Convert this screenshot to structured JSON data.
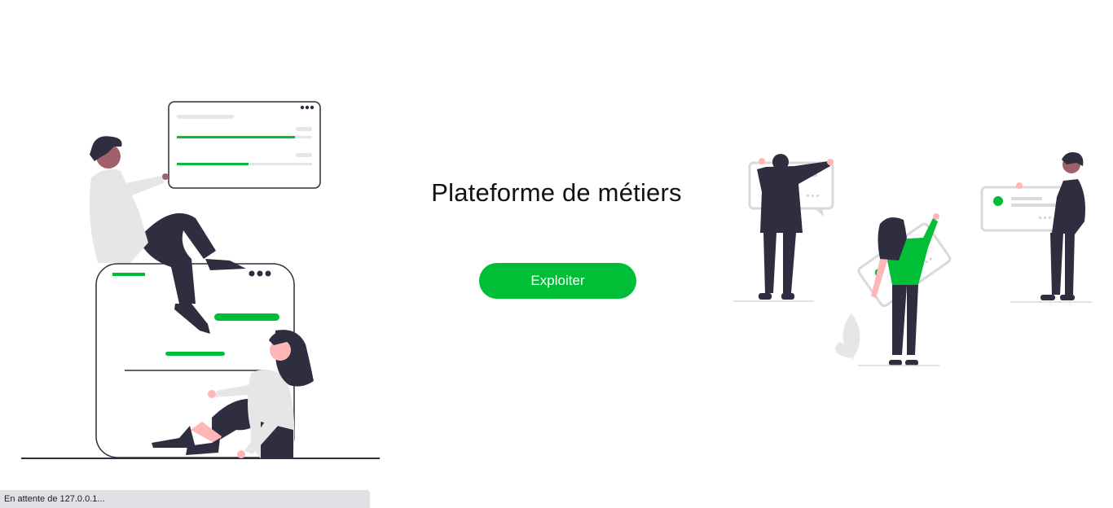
{
  "hero": {
    "title": "Plateforme de métiers",
    "cta_label": "Exploiter"
  },
  "status_bar": {
    "text": "En attente de 127.0.0.1..."
  },
  "colors": {
    "accent": "#00bf36",
    "dark": "#2f2e41",
    "light_gray": "#e6e6e6",
    "skin_pink": "#ffb6b6",
    "skin_dark": "#a0616a"
  },
  "illustrations": {
    "left": "people-with-dashboard-illustration",
    "right": "team-with-chat-bubbles-illustration"
  }
}
